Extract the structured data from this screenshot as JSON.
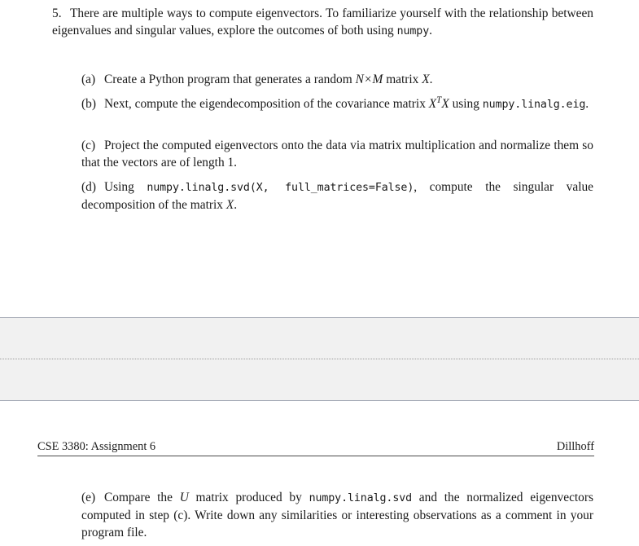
{
  "document": {
    "page_one": {
      "problem": {
        "marker": "5.",
        "text_before_code": "There are multiple ways to compute eigenvectors. To familiarize yourself with the relationship between eigenvalues and singular values, explore the outcomes of both using ",
        "code": "numpy",
        "text_after_code": "."
      },
      "subitems": [
        {
          "marker": "(a)",
          "segments": [
            {
              "type": "text",
              "value": "Create a Python program that generates a random "
            },
            {
              "type": "math",
              "value": "N"
            },
            {
              "type": "op",
              "value": "×"
            },
            {
              "type": "math",
              "value": "M"
            },
            {
              "type": "text",
              "value": " matrix "
            },
            {
              "type": "math",
              "value": "X"
            },
            {
              "type": "text",
              "value": "."
            }
          ]
        },
        {
          "marker": "(b)",
          "segments": [
            {
              "type": "text",
              "value": "Next, compute the eigendecomposition of the covariance matrix "
            },
            {
              "type": "math-sup",
              "base": "X",
              "sup": "T"
            },
            {
              "type": "math",
              "value": "X"
            },
            {
              "type": "text",
              "value": " using "
            },
            {
              "type": "code",
              "value": "numpy.linalg.eig"
            },
            {
              "type": "text",
              "value": "."
            }
          ]
        },
        {
          "marker": "(c)",
          "segments": [
            {
              "type": "text",
              "value": "Project the computed eigenvectors onto the data via matrix multiplication and normalize them so that the vectors are of length 1."
            }
          ]
        },
        {
          "marker": "(d)",
          "segments": [
            {
              "type": "text",
              "value": "Using "
            },
            {
              "type": "code",
              "value": "numpy.linalg.svd(X, full_matrices=False)"
            },
            {
              "type": "text",
              "value": ", compute the singular value decomposition of the matrix "
            },
            {
              "type": "math",
              "value": "X"
            },
            {
              "type": "text",
              "value": "."
            }
          ]
        }
      ]
    },
    "page_two": {
      "running_header": {
        "left": "CSE 3380: Assignment 6",
        "right": "Dillhoff"
      },
      "subitems": [
        {
          "marker": "(e)",
          "segments": [
            {
              "type": "text",
              "value": "Compare the "
            },
            {
              "type": "math",
              "value": "U"
            },
            {
              "type": "text",
              "value": " matrix produced by "
            },
            {
              "type": "code",
              "value": "numpy.linalg.svd"
            },
            {
              "type": "text",
              "value": " and the normalized eigenvectors computed in step (c). Write down any similarities or interesting observations as a comment in your program file."
            }
          ]
        }
      ]
    }
  },
  "page_break": {
    "background_color": "#f1f1f1",
    "border_color": "#a8adb8",
    "dotted_rule_color": "#9a9a9a"
  },
  "colors": {
    "page_background": "#ffffff",
    "text": "#1a1a1a",
    "rule": "#4a4a4a"
  }
}
